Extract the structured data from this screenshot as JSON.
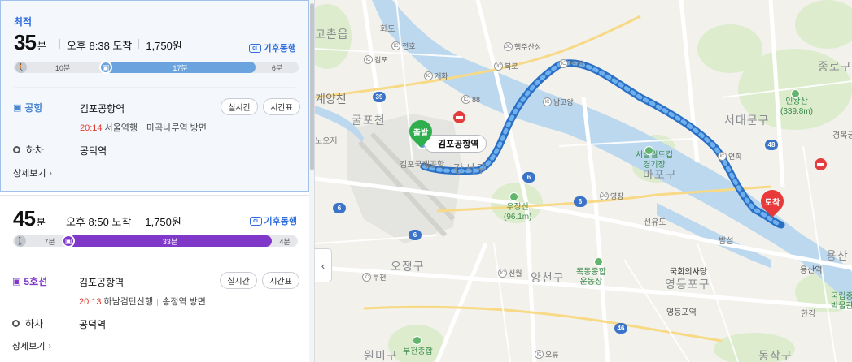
{
  "routes": [
    {
      "best_label": "최적",
      "duration_num": "35",
      "duration_unit": "분",
      "arrival": "오후 8:38 도착",
      "fare": "1,750원",
      "climate_badge": "기후동행",
      "climate_icon": "ci",
      "segments": [
        {
          "type": "walk",
          "label": "10분"
        },
        {
          "type": "ride",
          "label": "17분",
          "color": "#6aa3de"
        },
        {
          "type": "walk",
          "label": "6분"
        }
      ],
      "line_name": "공항",
      "line_color": "#4a86d0",
      "board_station": "김포공항역",
      "depart_time": "20:14",
      "direction": "서울역행",
      "next_station": "마곡나루역 방면",
      "realtime_button": "실시간",
      "timetable_button": "시간표",
      "alight_label": "하차",
      "alight_station": "공덕역",
      "detail_label": "상세보기"
    },
    {
      "best_label": "",
      "duration_num": "45",
      "duration_unit": "분",
      "arrival": "오후 8:50 도착",
      "fare": "1,750원",
      "climate_badge": "기후동행",
      "climate_icon": "ci",
      "segments": [
        {
          "type": "walk",
          "label": "7분"
        },
        {
          "type": "ride",
          "label": "33분",
          "color": "#7f38c8"
        },
        {
          "type": "walk",
          "label": "4분"
        }
      ],
      "line_name": "5호선",
      "line_color": "#7f38c8",
      "board_station": "김포공항역",
      "depart_time": "20:13",
      "direction": "하남검단산행",
      "next_station": "송정역 방면",
      "realtime_button": "실시간",
      "timetable_button": "시간표",
      "alight_label": "하차",
      "alight_station": "공덕역",
      "detail_label": "상세보기"
    }
  ],
  "map": {
    "collapse_icon": "chevron-left-icon",
    "collapse_glyph": "‹",
    "start_pin": "출발",
    "end_pin": "도착",
    "start_station_label": "김포공항역",
    "start_station_sub": "김포국제공항",
    "districts": [
      "고촌읍",
      "굴포천",
      "강서구",
      "마포구",
      "서대문구",
      "종로구",
      "용산",
      "오정구",
      "양천구",
      "영등포구",
      "원미구",
      "동작구",
      "계양천",
      "부천",
      "서부천",
      "용산구"
    ],
    "areas": [
      "화도",
      "전호",
      "김포",
      "개화",
      "김포공항",
      "행주산성",
      "북로",
      "남고양",
      "현천",
      "연희",
      "영장",
      "선유도",
      "밤섬",
      "신월",
      "부천",
      "오류",
      "한강",
      "노오지",
      "경복궁"
    ],
    "pois": [
      "인왕산\n(339.8m)",
      "서울월드컵\n경기장",
      "우장산\n(96.1m)",
      "목동종합\n운동장",
      "국회의사당",
      "영등포역",
      "부천종합",
      "국립중\n박물관",
      "용산역"
    ],
    "highways": [
      "39",
      "88",
      "6",
      "6",
      "6",
      "48",
      "46",
      "6"
    ],
    "ic_labels": [
      "전호",
      "김포",
      "개화",
      "88",
      "행주산성",
      "북로",
      "현천",
      "남고양",
      "연희",
      "영장",
      "신월",
      "부천",
      "오류"
    ]
  }
}
